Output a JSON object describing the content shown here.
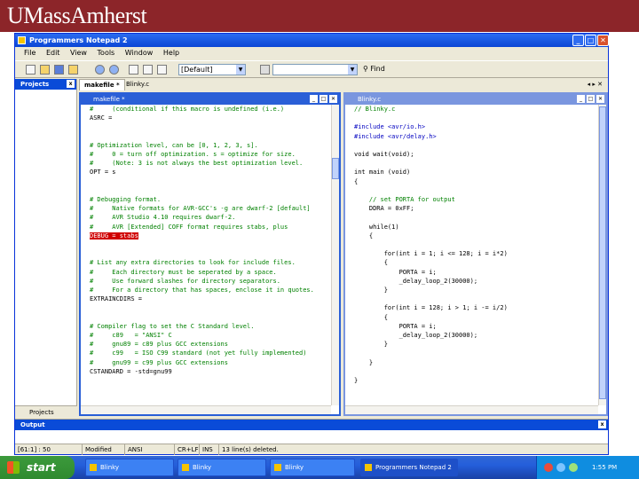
{
  "banner": {
    "brand": "UMassAmherst"
  },
  "window": {
    "title": "Programmers Notepad 2",
    "buttons": [
      "_",
      "□",
      "✕"
    ],
    "menu": [
      "File",
      "Edit",
      "View",
      "Tools",
      "Window",
      "Help"
    ],
    "toolbar": {
      "scheme_combo": "[Default]",
      "search_combo": "",
      "find_label": "Find"
    }
  },
  "projects": {
    "title": "Projects",
    "close": "x",
    "tab_label": "Projects"
  },
  "doc_tabs": [
    "makefile *",
    "Blinky.c"
  ],
  "makefile": {
    "title": "makefile *",
    "lines": [
      {
        "t": "#     (conditional if this macro is undefined (i.e.)",
        "cls": "c"
      },
      {
        "t": "ASRC =",
        "cls": ""
      },
      {
        "t": "",
        "cls": ""
      },
      {
        "t": "",
        "cls": ""
      },
      {
        "t": "# Optimization level, can be [0, 1, 2, 3, s].",
        "cls": "c"
      },
      {
        "t": "#     0 = turn off optimization. s = optimize for size.",
        "cls": "c"
      },
      {
        "t": "#     (Note: 3 is not always the best optimization level.",
        "cls": "c"
      },
      {
        "t": "OPT = s",
        "cls": ""
      },
      {
        "t": "",
        "cls": ""
      },
      {
        "t": "",
        "cls": ""
      },
      {
        "t": "# Debugging format.",
        "cls": "c"
      },
      {
        "t": "#     Native formats for AVR-GCC's -g are dwarf-2 [default]",
        "cls": "c"
      },
      {
        "t": "#     AVR Studio 4.10 requires dwarf-2.",
        "cls": "c"
      },
      {
        "t": "#     AVR [Extended] COFF format requires stabs, plus",
        "cls": "c"
      },
      {
        "t": "DEBUG = stabs",
        "cls": "hl"
      },
      {
        "t": "",
        "cls": ""
      },
      {
        "t": "",
        "cls": ""
      },
      {
        "t": "# List any extra directories to look for include files.",
        "cls": "c"
      },
      {
        "t": "#     Each directory must be seperated by a space.",
        "cls": "c"
      },
      {
        "t": "#     Use forward slashes for directory separators.",
        "cls": "c"
      },
      {
        "t": "#     For a directory that has spaces, enclose it in quotes.",
        "cls": "c"
      },
      {
        "t": "EXTRAINCDIRS =",
        "cls": ""
      },
      {
        "t": "",
        "cls": ""
      },
      {
        "t": "",
        "cls": ""
      },
      {
        "t": "# Compiler flag to set the C Standard level.",
        "cls": "c"
      },
      {
        "t": "#     c89   = \"ANSI\" C",
        "cls": "c"
      },
      {
        "t": "#     gnu89 = c89 plus GCC extensions",
        "cls": "c"
      },
      {
        "t": "#     c99   = ISO C99 standard (not yet fully implemented)",
        "cls": "c"
      },
      {
        "t": "#     gnu99 = c99 plus GCC extensions",
        "cls": "c"
      },
      {
        "t": "CSTANDARD = -std=gnu99",
        "cls": ""
      }
    ]
  },
  "blinky": {
    "title": "Blinky.c",
    "lines": [
      {
        "t": "// Blinky.c",
        "cls": "c"
      },
      {
        "t": "",
        "cls": ""
      },
      {
        "t": "#include <avr/io.h>",
        "cls": "k"
      },
      {
        "t": "#include <avr/delay.h>",
        "cls": "k"
      },
      {
        "t": "",
        "cls": ""
      },
      {
        "t": "void wait(void);",
        "cls": ""
      },
      {
        "t": "",
        "cls": ""
      },
      {
        "t": "int main (void)",
        "cls": ""
      },
      {
        "t": "{",
        "cls": ""
      },
      {
        "t": "",
        "cls": ""
      },
      {
        "t": "    // set PORTA for output",
        "cls": "c"
      },
      {
        "t": "    DDRA = 0xFF;",
        "cls": ""
      },
      {
        "t": "",
        "cls": ""
      },
      {
        "t": "    while(1)",
        "cls": ""
      },
      {
        "t": "    {",
        "cls": ""
      },
      {
        "t": "",
        "cls": ""
      },
      {
        "t": "        for(int i = 1; i <= 128; i = i*2)",
        "cls": ""
      },
      {
        "t": "        {",
        "cls": ""
      },
      {
        "t": "            PORTA = i;",
        "cls": ""
      },
      {
        "t": "            _delay_loop_2(30000);",
        "cls": ""
      },
      {
        "t": "        }",
        "cls": ""
      },
      {
        "t": "",
        "cls": ""
      },
      {
        "t": "        for(int i = 128; i > 1; i -= i/2)",
        "cls": ""
      },
      {
        "t": "        {",
        "cls": ""
      },
      {
        "t": "            PORTA = i;",
        "cls": ""
      },
      {
        "t": "            _delay_loop_2(30000);",
        "cls": ""
      },
      {
        "t": "        }",
        "cls": ""
      },
      {
        "t": "",
        "cls": ""
      },
      {
        "t": "    }",
        "cls": ""
      },
      {
        "t": "",
        "cls": ""
      },
      {
        "t": "}",
        "cls": ""
      }
    ]
  },
  "output": {
    "title": "Output",
    "close": "x"
  },
  "status": {
    "position": "[61:1] : 50",
    "modified": "Modified",
    "scheme": "ANSI",
    "eol": "CR+LF",
    "ins": "INS",
    "message": "13 line(s) deleted."
  },
  "taskbar": {
    "start": "start",
    "tasks": [
      "Blinky",
      "Blinky",
      "Blinky",
      "Programmers Notepad 2"
    ],
    "clock": "1:55 PM"
  },
  "colors": {
    "banner": "#8c2529",
    "titlebar": "#0b46d5",
    "highlight": "#d00000",
    "comment": "#008000"
  }
}
